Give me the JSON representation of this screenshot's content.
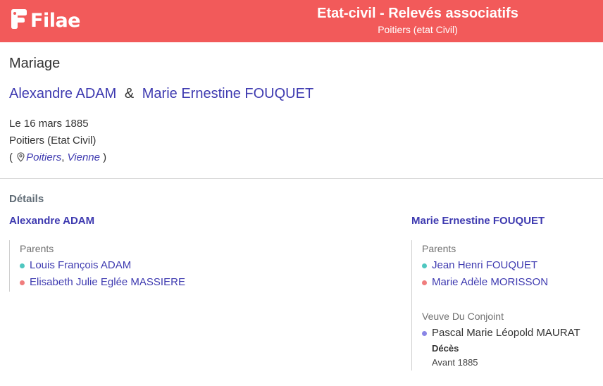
{
  "header": {
    "logo_text": "Filae",
    "title": "Etat-civil - Relevés associatifs",
    "subtitle": "Poitiers (etat Civil)",
    "background_color": "#f25a5a"
  },
  "record": {
    "type": "Mariage",
    "spouse1": "Alexandre ADAM",
    "ampersand": "&",
    "spouse2": "Marie Ernestine FOUQUET",
    "date": "Le 16 mars 1885",
    "source": "Poitiers (Etat Civil)",
    "location": {
      "open_paren": "(",
      "icon": "map-pin-icon",
      "city": "Poitiers",
      "comma": ",",
      "department": "Vienne",
      "close_paren": ")"
    }
  },
  "details": {
    "label": "Détails",
    "left": {
      "name": "Alexandre ADAM",
      "parents_label": "Parents",
      "parents": [
        {
          "name": "Louis François ADAM",
          "dot_color": "#4fc7c0"
        },
        {
          "name": "Elisabeth Julie Eglée MASSIERE",
          "dot_color": "#f07d7d"
        }
      ]
    },
    "right": {
      "name": "Marie Ernestine FOUQUET",
      "parents_label": "Parents",
      "parents": [
        {
          "name": "Jean Henri FOUQUET",
          "dot_color": "#4fc7c0"
        },
        {
          "name": "Marie Adèle MORISSON",
          "dot_color": "#f07d7d"
        }
      ],
      "widow_label": "Veuve Du Conjoint",
      "previous_spouse": {
        "name": "Pascal Marie Léopold MAURAT",
        "dot_color": "#8a86e6",
        "event_label": "Décès",
        "event_date": "Avant 1885"
      }
    }
  }
}
